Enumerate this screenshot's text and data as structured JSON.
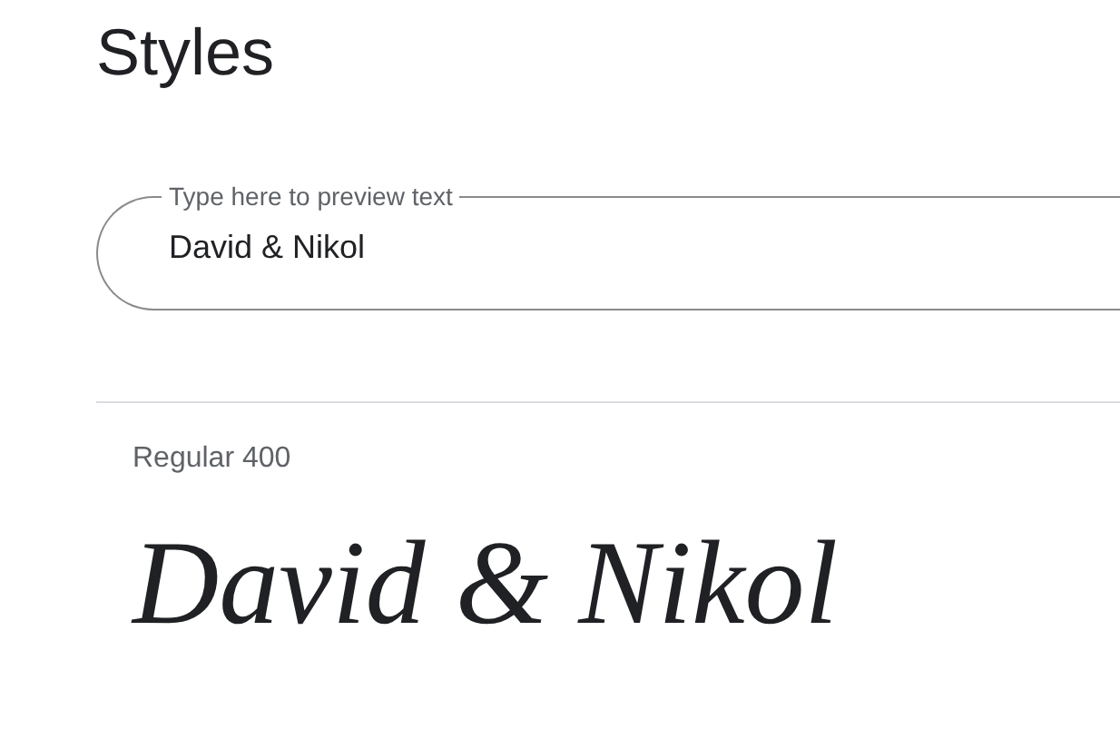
{
  "heading": "Styles",
  "preview_field": {
    "placeholder": "Type here to preview text",
    "value": "David & Nikol"
  },
  "styles": [
    {
      "name": "Regular 400",
      "sample": "David & Nikol"
    }
  ]
}
